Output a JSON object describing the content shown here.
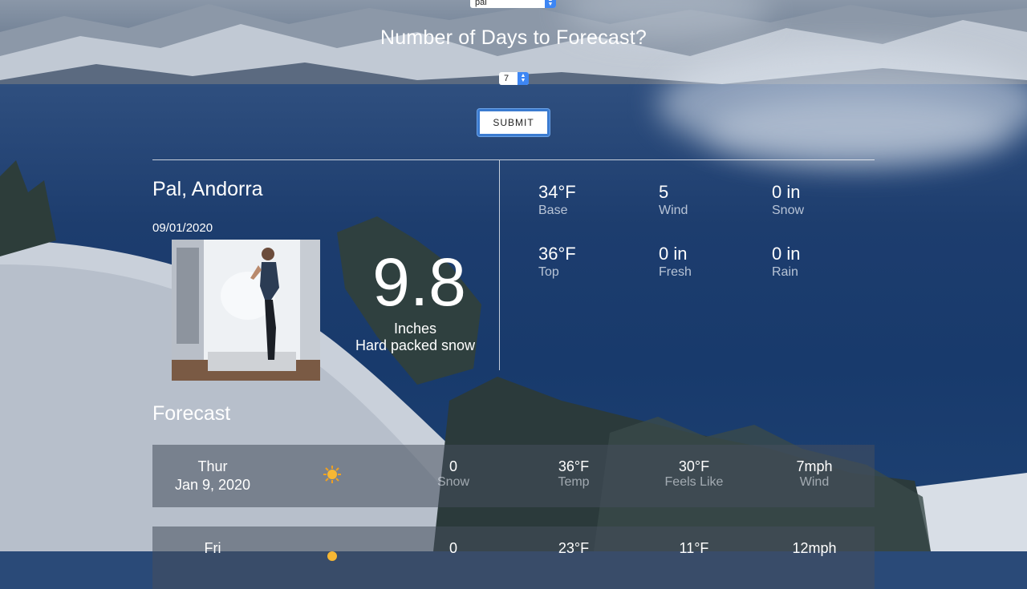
{
  "controls": {
    "location_value": "pal",
    "question": "Number of Days to Forecast?",
    "days_value": "7",
    "submit_label": "SUBMIT"
  },
  "current": {
    "resort": "Pal, Andorra",
    "date": "09/01/2020",
    "depth": "9.8",
    "depth_unit": "Inches",
    "condition": "Hard packed snow",
    "stats": [
      {
        "value": "34°F",
        "label": "Base"
      },
      {
        "value": "5",
        "label": "Wind"
      },
      {
        "value": "0 in",
        "label": "Snow"
      },
      {
        "value": "36°F",
        "label": "Top"
      },
      {
        "value": "0 in",
        "label": "Fresh"
      },
      {
        "value": "0 in",
        "label": "Rain"
      }
    ]
  },
  "forecast": {
    "title": "Forecast",
    "days": [
      {
        "day": "Thur",
        "date": "Jan 9, 2020",
        "icon": "sun-icon",
        "snow": "0",
        "snow_label": "Snow",
        "temp": "36°F",
        "temp_label": "Temp",
        "feels": "30°F",
        "feels_label": "Feels Like",
        "wind": "7mph",
        "wind_label": "Wind"
      },
      {
        "day": "Fri",
        "date": "",
        "icon": "sun-icon",
        "snow": "0",
        "snow_label": "",
        "temp": "23°F",
        "temp_label": "",
        "feels": "11°F",
        "feels_label": "",
        "wind": "12mph",
        "wind_label": ""
      }
    ]
  },
  "colors": {
    "accent": "#3d86f4",
    "button_border": "#3b7bd0"
  }
}
